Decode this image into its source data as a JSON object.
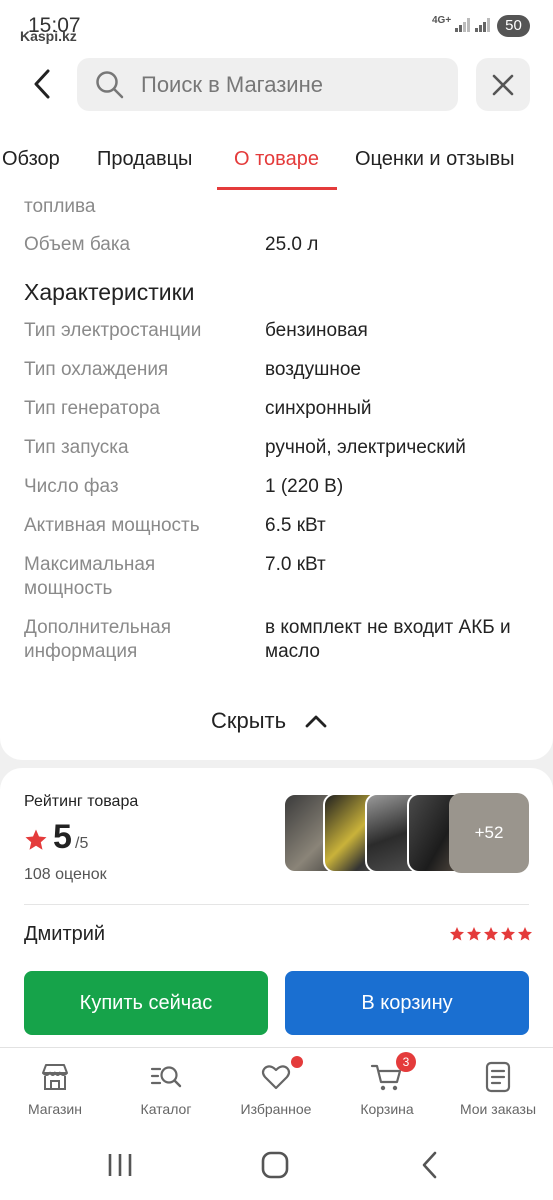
{
  "status_bar": {
    "time": "15:07",
    "app_name": "Kaspi.kz",
    "network": "4G+",
    "battery": "50"
  },
  "search": {
    "placeholder": "Поиск в Магазине"
  },
  "tabs": [
    {
      "label": "Обзор",
      "active": false
    },
    {
      "label": "Продавцы",
      "active": false
    },
    {
      "label": "О товаре",
      "active": true
    },
    {
      "label": "Оценки и отзывы",
      "active": false
    }
  ],
  "specs": {
    "partial_label": "топлива",
    "rows_top": [
      {
        "label": "Объем бака",
        "value": "25.0 л"
      }
    ],
    "section_title": "Характеристики",
    "rows": [
      {
        "label": "Тип электростанции",
        "value": "бензиновая"
      },
      {
        "label": "Тип охлаждения",
        "value": "воздушное"
      },
      {
        "label": "Тип генератора",
        "value": "синхронный"
      },
      {
        "label": "Тип запуска",
        "value": "ручной, электрический"
      },
      {
        "label": "Число фаз",
        "value": "1 (220 В)"
      },
      {
        "label": "Активная мощность",
        "value": "6.5 кВт"
      },
      {
        "label": "Максимальная мощность",
        "value": "7.0 кВт"
      },
      {
        "label": "Дополнительная информация",
        "value": "в комплект не входит АКБ и масло"
      }
    ],
    "hide_label": "Скрыть"
  },
  "rating": {
    "title": "Рейтинг товара",
    "value": "5",
    "max": "/5",
    "count": "108 оценок",
    "more_photos": "+52"
  },
  "review": {
    "author": "Дмитрий",
    "stars": 5,
    "star_color": "#e43b3b"
  },
  "actions": {
    "buy_now": "Купить сейчас",
    "add_to_cart": "В корзину"
  },
  "bottom_nav": [
    {
      "label": "Магазин",
      "icon": "store-icon"
    },
    {
      "label": "Каталог",
      "icon": "catalog-search-icon"
    },
    {
      "label": "Избранное",
      "icon": "heart-icon",
      "badge_dot": true
    },
    {
      "label": "Корзина",
      "icon": "cart-icon",
      "badge": "3"
    },
    {
      "label": "Мои заказы",
      "icon": "orders-icon"
    }
  ],
  "colors": {
    "accent_red": "#e43b3b",
    "buy_green": "#16a34a",
    "cart_blue": "#1a6fd1"
  }
}
